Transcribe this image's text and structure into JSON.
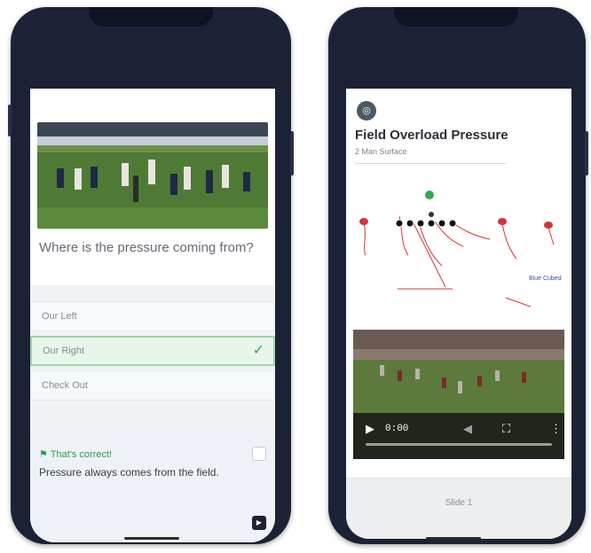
{
  "quiz": {
    "question": "Where is the pressure coming from?",
    "options": [
      {
        "label": "Our Left",
        "selected": false
      },
      {
        "label": "Our Right",
        "selected": true
      },
      {
        "label": "Check Out",
        "selected": false
      }
    ],
    "feedback": {
      "title": "That's correct!",
      "text": "Pressure always comes from the field."
    }
  },
  "slide": {
    "title": "Field Overload Pressure",
    "subtitle": "2 Man Surface",
    "diagram_note": "Blue Cubed",
    "video_time": "0:00",
    "footer_label": "Slide 1"
  },
  "colors": {
    "phone_frame": "#1c2236",
    "correct_green": "#3aa64f",
    "selected_bg": "#e8f6ea",
    "feedback_bg": "#eef1f8"
  }
}
